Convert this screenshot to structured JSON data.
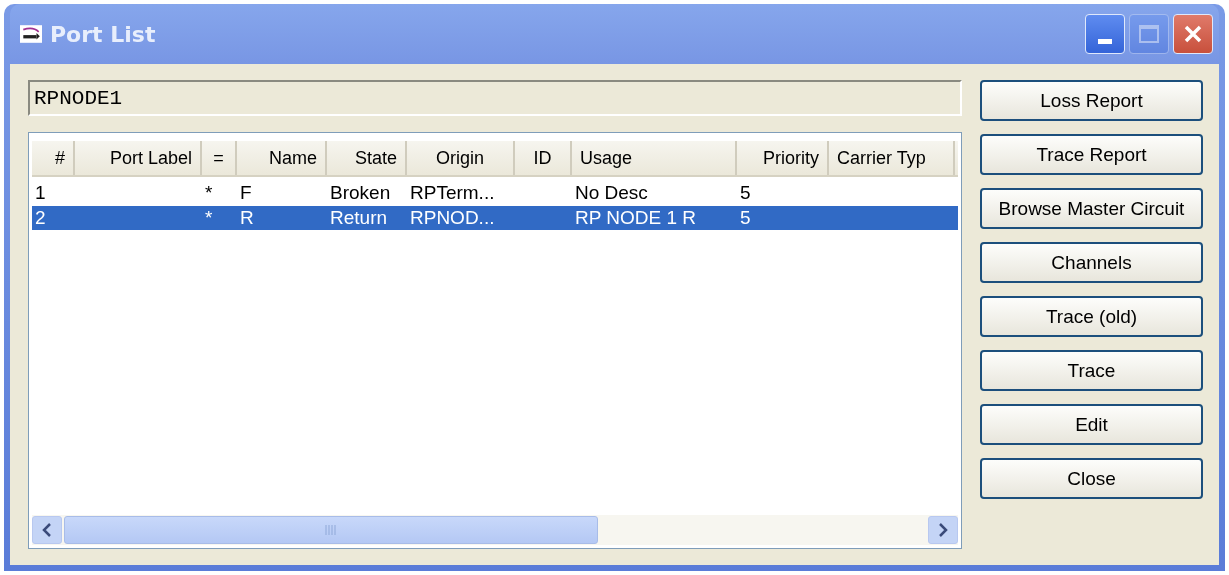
{
  "window": {
    "title": "Port List",
    "controls": [
      {
        "kind": "minimize",
        "disabled": false
      },
      {
        "kind": "maximize",
        "disabled": true
      },
      {
        "kind": "close",
        "disabled": false
      }
    ]
  },
  "node_field": {
    "value": "RPNODE1"
  },
  "table": {
    "columns": [
      "#",
      "Port Label",
      "=",
      "Name",
      "State",
      "Origin",
      "ID",
      "Usage",
      "Priority",
      "Carrier Typ"
    ],
    "rows": [
      {
        "cells": [
          "1",
          "",
          "*",
          "F",
          "Broken",
          "RPTerm...",
          "",
          "No Desc",
          "5",
          ""
        ],
        "selected": false
      },
      {
        "cells": [
          "2",
          "",
          "*",
          "R",
          "Return",
          "RPNOD...",
          "",
          "RP NODE 1 R",
          "5",
          ""
        ],
        "selected": true
      }
    ]
  },
  "buttons": [
    "Loss Report",
    "Trace Report",
    "Browse Master Circuit",
    "Channels",
    "Trace (old)",
    "Trace",
    "Edit",
    "Close"
  ]
}
